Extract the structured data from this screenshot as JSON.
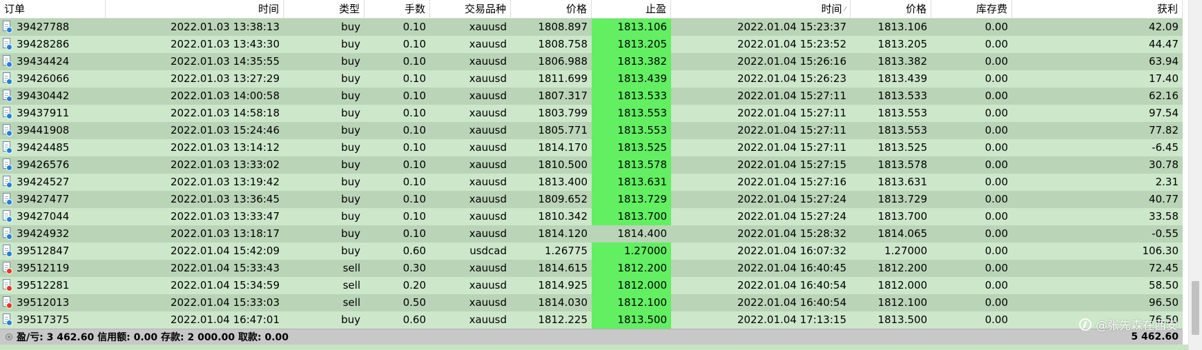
{
  "columns": {
    "order": "订单",
    "open_time": "时间",
    "type": "类型",
    "lots": "手数",
    "symbol": "交易品种",
    "open_price": "价格",
    "take_profit": "止盈",
    "close_time": "时间",
    "close_time_sort_indicator": "⁄",
    "close_price": "价格",
    "swap": "库存费",
    "profit": "获利"
  },
  "rows": [
    {
      "order": "39427788",
      "open_time": "2022.01.03 13:38:13",
      "type": "buy",
      "lots": "0.10",
      "symbol": "xauusd",
      "open_price": "1808.897",
      "take_profit": "1813.106",
      "tp_hit": true,
      "close_time": "2022.01.04 15:23:37",
      "close_price": "1813.106",
      "swap": "0.00",
      "profit": "42.09"
    },
    {
      "order": "39428286",
      "open_time": "2022.01.03 13:43:30",
      "type": "buy",
      "lots": "0.10",
      "symbol": "xauusd",
      "open_price": "1808.758",
      "take_profit": "1813.205",
      "tp_hit": true,
      "close_time": "2022.01.04 15:23:52",
      "close_price": "1813.205",
      "swap": "0.00",
      "profit": "44.47"
    },
    {
      "order": "39434424",
      "open_time": "2022.01.03 14:35:55",
      "type": "buy",
      "lots": "0.10",
      "symbol": "xauusd",
      "open_price": "1806.988",
      "take_profit": "1813.382",
      "tp_hit": true,
      "close_time": "2022.01.04 15:26:16",
      "close_price": "1813.382",
      "swap": "0.00",
      "profit": "63.94"
    },
    {
      "order": "39426066",
      "open_time": "2022.01.03 13:27:29",
      "type": "buy",
      "lots": "0.10",
      "symbol": "xauusd",
      "open_price": "1811.699",
      "take_profit": "1813.439",
      "tp_hit": true,
      "close_time": "2022.01.04 15:26:23",
      "close_price": "1813.439",
      "swap": "0.00",
      "profit": "17.40"
    },
    {
      "order": "39430442",
      "open_time": "2022.01.03 14:00:58",
      "type": "buy",
      "lots": "0.10",
      "symbol": "xauusd",
      "open_price": "1807.317",
      "take_profit": "1813.533",
      "tp_hit": true,
      "close_time": "2022.01.04 15:27:11",
      "close_price": "1813.533",
      "swap": "0.00",
      "profit": "62.16"
    },
    {
      "order": "39437911",
      "open_time": "2022.01.03 14:58:18",
      "type": "buy",
      "lots": "0.10",
      "symbol": "xauusd",
      "open_price": "1803.799",
      "take_profit": "1813.553",
      "tp_hit": true,
      "close_time": "2022.01.04 15:27:11",
      "close_price": "1813.553",
      "swap": "0.00",
      "profit": "97.54"
    },
    {
      "order": "39441908",
      "open_time": "2022.01.03 15:24:46",
      "type": "buy",
      "lots": "0.10",
      "symbol": "xauusd",
      "open_price": "1805.771",
      "take_profit": "1813.553",
      "tp_hit": true,
      "close_time": "2022.01.04 15:27:11",
      "close_price": "1813.553",
      "swap": "0.00",
      "profit": "77.82"
    },
    {
      "order": "39424485",
      "open_time": "2022.01.03 13:14:12",
      "type": "buy",
      "lots": "0.10",
      "symbol": "xauusd",
      "open_price": "1814.170",
      "take_profit": "1813.525",
      "tp_hit": true,
      "close_time": "2022.01.04 15:27:11",
      "close_price": "1813.525",
      "swap": "0.00",
      "profit": "-6.45"
    },
    {
      "order": "39426576",
      "open_time": "2022.01.03 13:33:02",
      "type": "buy",
      "lots": "0.10",
      "symbol": "xauusd",
      "open_price": "1810.500",
      "take_profit": "1813.578",
      "tp_hit": true,
      "close_time": "2022.01.04 15:27:15",
      "close_price": "1813.578",
      "swap": "0.00",
      "profit": "30.78"
    },
    {
      "order": "39424527",
      "open_time": "2022.01.03 13:19:42",
      "type": "buy",
      "lots": "0.10",
      "symbol": "xauusd",
      "open_price": "1813.400",
      "take_profit": "1813.631",
      "tp_hit": true,
      "close_time": "2022.01.04 15:27:16",
      "close_price": "1813.631",
      "swap": "0.00",
      "profit": "2.31"
    },
    {
      "order": "39427477",
      "open_time": "2022.01.03 13:36:45",
      "type": "buy",
      "lots": "0.10",
      "symbol": "xauusd",
      "open_price": "1809.652",
      "take_profit": "1813.729",
      "tp_hit": true,
      "close_time": "2022.01.04 15:27:24",
      "close_price": "1813.729",
      "swap": "0.00",
      "profit": "40.77"
    },
    {
      "order": "39427044",
      "open_time": "2022.01.03 13:33:47",
      "type": "buy",
      "lots": "0.10",
      "symbol": "xauusd",
      "open_price": "1810.342",
      "take_profit": "1813.700",
      "tp_hit": true,
      "close_time": "2022.01.04 15:27:24",
      "close_price": "1813.700",
      "swap": "0.00",
      "profit": "33.58"
    },
    {
      "order": "39424932",
      "open_time": "2022.01.03 13:18:17",
      "type": "buy",
      "lots": "0.10",
      "symbol": "xauusd",
      "open_price": "1814.120",
      "take_profit": "1814.400",
      "tp_hit": false,
      "close_time": "2022.01.04 15:28:32",
      "close_price": "1814.065",
      "swap": "0.00",
      "profit": "-0.55"
    },
    {
      "order": "39512847",
      "open_time": "2022.01.04 15:42:09",
      "type": "buy",
      "lots": "0.60",
      "symbol": "usdcad",
      "open_price": "1.26775",
      "take_profit": "1.27000",
      "tp_hit": true,
      "close_time": "2022.01.04 16:07:32",
      "close_price": "1.27000",
      "swap": "0.00",
      "profit": "106.30"
    },
    {
      "order": "39512119",
      "open_time": "2022.01.04 15:33:43",
      "type": "sell",
      "lots": "0.30",
      "symbol": "xauusd",
      "open_price": "1814.615",
      "take_profit": "1812.200",
      "tp_hit": true,
      "close_time": "2022.01.04 16:40:45",
      "close_price": "1812.200",
      "swap": "0.00",
      "profit": "72.45"
    },
    {
      "order": "39512281",
      "open_time": "2022.01.04 15:34:59",
      "type": "sell",
      "lots": "0.20",
      "symbol": "xauusd",
      "open_price": "1814.925",
      "take_profit": "1812.000",
      "tp_hit": true,
      "close_time": "2022.01.04 16:40:54",
      "close_price": "1812.000",
      "swap": "0.00",
      "profit": "58.50"
    },
    {
      "order": "39512013",
      "open_time": "2022.01.04 15:33:03",
      "type": "sell",
      "lots": "0.50",
      "symbol": "xauusd",
      "open_price": "1814.030",
      "take_profit": "1812.100",
      "tp_hit": true,
      "close_time": "2022.01.04 16:40:54",
      "close_price": "1812.100",
      "swap": "0.00",
      "profit": "96.50"
    },
    {
      "order": "39517375",
      "open_time": "2022.01.04 16:47:01",
      "type": "buy",
      "lots": "0.60",
      "symbol": "xauusd",
      "open_price": "1812.225",
      "take_profit": "1813.500",
      "tp_hit": true,
      "close_time": "2022.01.04 17:13:15",
      "close_price": "1813.500",
      "swap": "0.00",
      "profit": "76.50"
    }
  ],
  "summary": {
    "text": "盈/亏: 3 462.60  信用额: 0.00  存款: 2 000.00  取款: 0.00",
    "total": "5 462.60"
  },
  "watermark": "@张先森在西安",
  "colors": {
    "row_odd": "#bad4b7",
    "row_even": "#cde7cb",
    "tp_highlight": "#62ef62",
    "buy_dot": "#1f82d8",
    "sell_dot": "#e0391f",
    "summary_bar": "#c8c8c8"
  },
  "icons": {
    "row_buy": "order-document-buy-icon",
    "row_sell": "order-document-sell-icon",
    "summary": "summary-circle-icon",
    "watermark": "weibo-logo-icon"
  }
}
